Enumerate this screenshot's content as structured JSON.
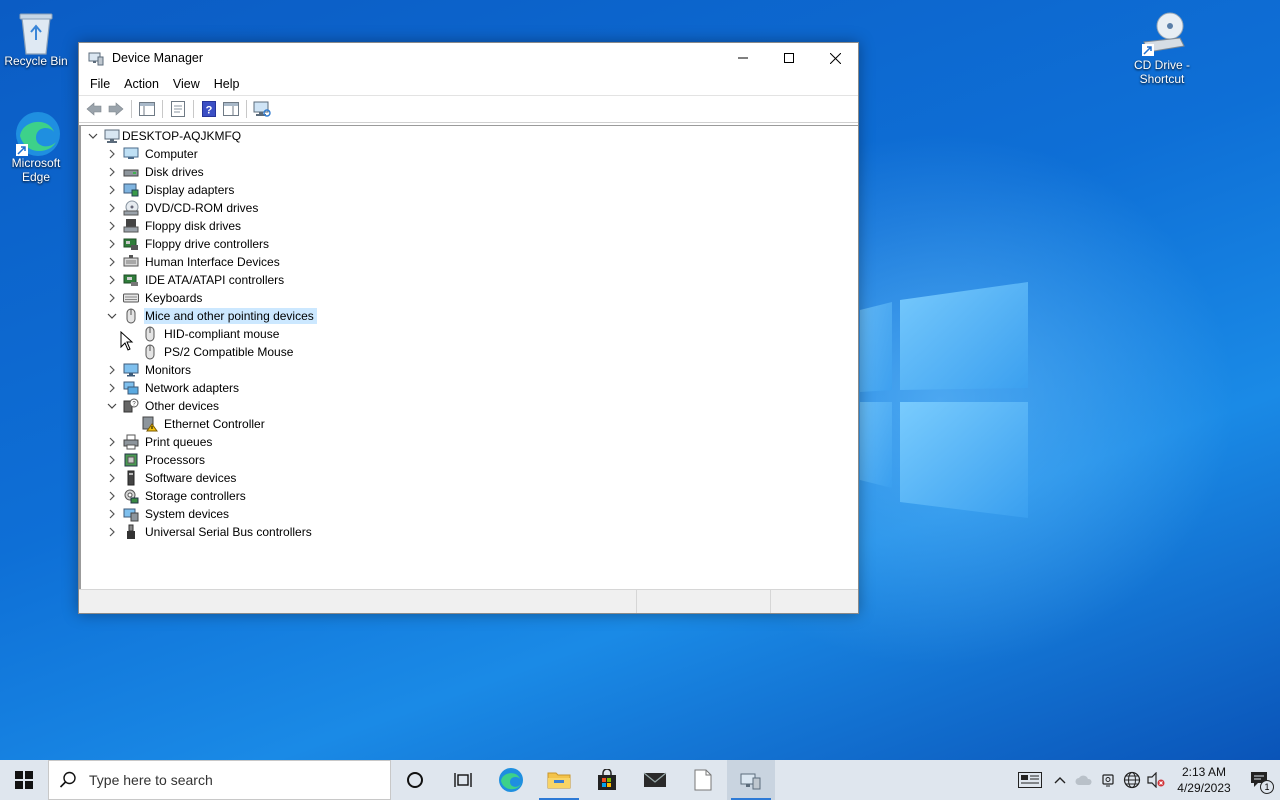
{
  "desktop": {
    "icons": [
      {
        "label": "Recycle Bin"
      },
      {
        "label": "Microsoft Edge"
      },
      {
        "label": "CD Drive - Shortcut"
      }
    ]
  },
  "window": {
    "title": "Device Manager",
    "menu": [
      "File",
      "Action",
      "View",
      "Help"
    ],
    "tree": {
      "root": "DESKTOP-AQJKMFQ",
      "items": [
        {
          "label": "Computer",
          "icon": "computer-icon",
          "expanded": false
        },
        {
          "label": "Disk drives",
          "icon": "disk-drive-icon",
          "expanded": false
        },
        {
          "label": "Display adapters",
          "icon": "display-adapter-icon",
          "expanded": false
        },
        {
          "label": "DVD/CD-ROM drives",
          "icon": "dvd-drive-icon",
          "expanded": false
        },
        {
          "label": "Floppy disk drives",
          "icon": "floppy-disk-icon",
          "expanded": false
        },
        {
          "label": "Floppy drive controllers",
          "icon": "floppy-controller-icon",
          "expanded": false
        },
        {
          "label": "Human Interface Devices",
          "icon": "hid-icon",
          "expanded": false
        },
        {
          "label": "IDE ATA/ATAPI controllers",
          "icon": "ide-controller-icon",
          "expanded": false
        },
        {
          "label": "Keyboards",
          "icon": "keyboard-icon",
          "expanded": false
        },
        {
          "label": "Mice and other pointing devices",
          "icon": "mouse-icon",
          "expanded": true,
          "selected": true,
          "children": [
            "HID-compliant mouse",
            "PS/2 Compatible Mouse"
          ]
        },
        {
          "label": "Monitors",
          "icon": "monitor-icon",
          "expanded": false
        },
        {
          "label": "Network adapters",
          "icon": "network-adapter-icon",
          "expanded": false
        },
        {
          "label": "Other devices",
          "icon": "unknown-device-icon",
          "expanded": true,
          "children": [
            "Ethernet Controller"
          ]
        },
        {
          "label": "Print queues",
          "icon": "printer-icon",
          "expanded": false
        },
        {
          "label": "Processors",
          "icon": "processor-icon",
          "expanded": false
        },
        {
          "label": "Software devices",
          "icon": "software-device-icon",
          "expanded": false
        },
        {
          "label": "Storage controllers",
          "icon": "storage-controller-icon",
          "expanded": false
        },
        {
          "label": "System devices",
          "icon": "system-device-icon",
          "expanded": false
        },
        {
          "label": "Universal Serial Bus controllers",
          "icon": "usb-icon",
          "expanded": false
        }
      ]
    }
  },
  "taskbar": {
    "search_placeholder": "Type here to search",
    "time": "2:13 AM",
    "date": "4/29/2023",
    "notification_count": "1"
  },
  "colors": {
    "selection": "#cce8ff",
    "accent": "#2d7ad6"
  }
}
